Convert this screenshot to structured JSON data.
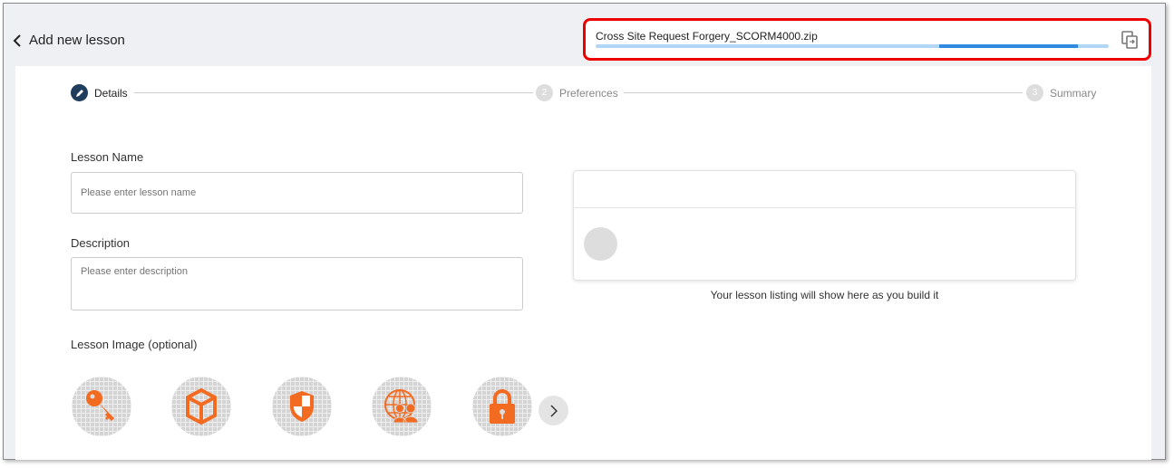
{
  "header": {
    "back_label": "Add new lesson"
  },
  "upload": {
    "file_name": "Cross Site Request Forgery_SCORM4000.zip",
    "progress_segment_start": 0.67,
    "progress_segment_end": 0.94,
    "accent": "#2f8ae0",
    "border_color": "#e00000"
  },
  "steps": [
    {
      "number": "1",
      "label": "Details",
      "icon": "pencil-icon",
      "active": true
    },
    {
      "number": "2",
      "label": "Preferences"
    },
    {
      "number": "3",
      "label": "Summary"
    }
  ],
  "form": {
    "lesson_name_label": "Lesson Name",
    "lesson_name_placeholder": "Please enter lesson name",
    "description_label": "Description",
    "description_placeholder": "Please enter description",
    "image_label": "Lesson Image (optional)",
    "images": [
      "key-icon",
      "cube-icon",
      "shield-icon",
      "globe-users-icon",
      "padlock-icon"
    ]
  },
  "preview": {
    "hint": "Your lesson listing will show here as you build it"
  }
}
